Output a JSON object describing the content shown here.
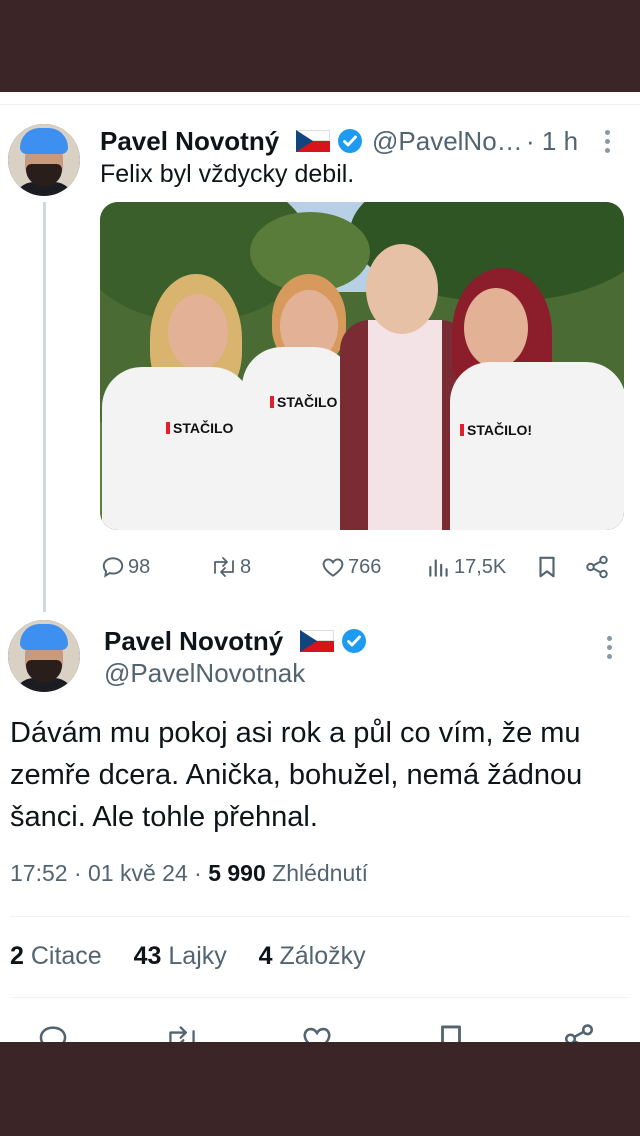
{
  "tweet1": {
    "name": "Pavel Novotný",
    "handle": "@PavelNo…",
    "time": "· 1 h",
    "text": "Felix byl vždycky debil.",
    "photo_shirt_text": "STAČILO",
    "photo_shirt_text2": "STAČILO!",
    "replies": "98",
    "retweets": "8",
    "likes": "766",
    "views": "17,5K"
  },
  "tweet2": {
    "name": "Pavel Novotný",
    "handle": "@PavelNovotnak",
    "text": "Dávám mu pokoj asi rok a půl co vím, že mu zemře dcera. Anička, bohužel, nemá žádnou šanci. Ale tohle přehnal.",
    "time": "17:52 · 01 kvě 24 · ",
    "views_count": "5 990",
    "views_label": " Zhlédnutí",
    "quotes_count": "2",
    "quotes_label": " Citace",
    "likes_count": "43",
    "likes_label": " Lajky",
    "bookmarks_count": "4",
    "bookmarks_label": " Záložky"
  },
  "icons": [
    "reply-icon",
    "retweet-icon",
    "like-icon",
    "views-icon",
    "bookmark-icon",
    "share-icon",
    "verified-icon",
    "more-icon",
    "czech-flag-icon"
  ],
  "colors": {
    "verified": "#1d9bf0",
    "text": "#0f1419",
    "secondary": "#536471",
    "frame": "#3b2526"
  }
}
